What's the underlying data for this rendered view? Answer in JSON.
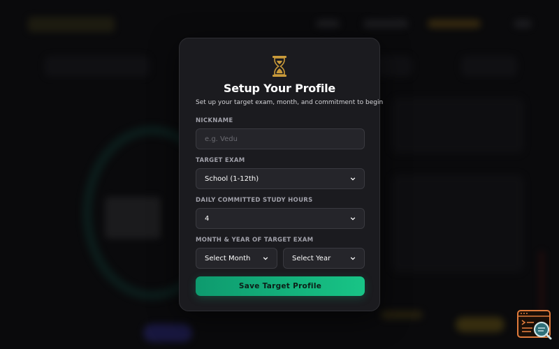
{
  "modal": {
    "title": "Setup Your Profile",
    "subtitle": "Set up your target exam, month, and commitment to begin",
    "icon": "hourglass-icon",
    "nickname": {
      "label": "NICKNAME",
      "placeholder": "e.g. Vedu",
      "value": ""
    },
    "target_exam": {
      "label": "TARGET EXAM",
      "selected": "School (1-12th)"
    },
    "study_hours": {
      "label": "DAILY COMMITTED STUDY HOURS",
      "selected": "4"
    },
    "month_year": {
      "label": "MONTH & YEAR OF TARGET EXAM",
      "month_selected": "Select Month",
      "year_selected": "Select Year"
    },
    "save_label": "Save Target Profile"
  },
  "colors": {
    "accent_green": "#10b981",
    "gold": "#c99a3a",
    "modal_bg": "#1b1b1f",
    "widget_orange": "#e07b3c",
    "widget_teal": "#2f6f78"
  },
  "widget": {
    "icon": "console-search-icon"
  }
}
